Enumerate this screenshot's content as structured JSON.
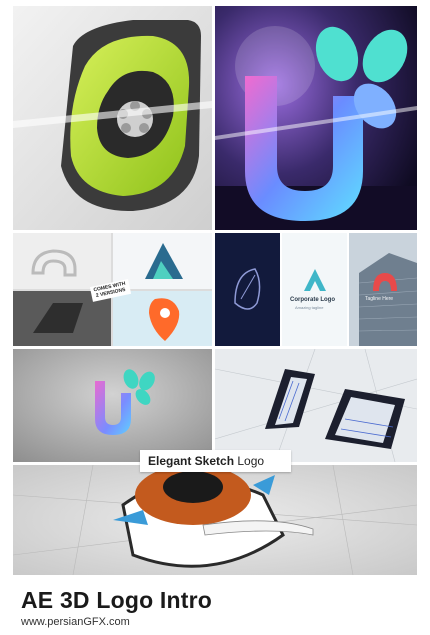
{
  "footer": {
    "title": "AE 3D Logo Intro",
    "url": "www.persianGFX.com"
  },
  "tiles": {
    "grid_badge": {
      "line1": "COMES WITH",
      "line2": "2 VERSIONS"
    },
    "corporate": {
      "title": "Corporate Logo",
      "subtitle": "Amazing tagline"
    },
    "tower": {
      "label": "Tagline Here"
    },
    "sketch_banner": {
      "bold": "Elegant Sketch",
      "normal": "Logo"
    }
  },
  "colors": {
    "accent_green": "#b6e02a",
    "accent_teal": "#3fd6c2",
    "accent_orange": "#ff6a2a",
    "accent_red": "#e83b3b",
    "stage_purple": "#3a2a6b"
  }
}
